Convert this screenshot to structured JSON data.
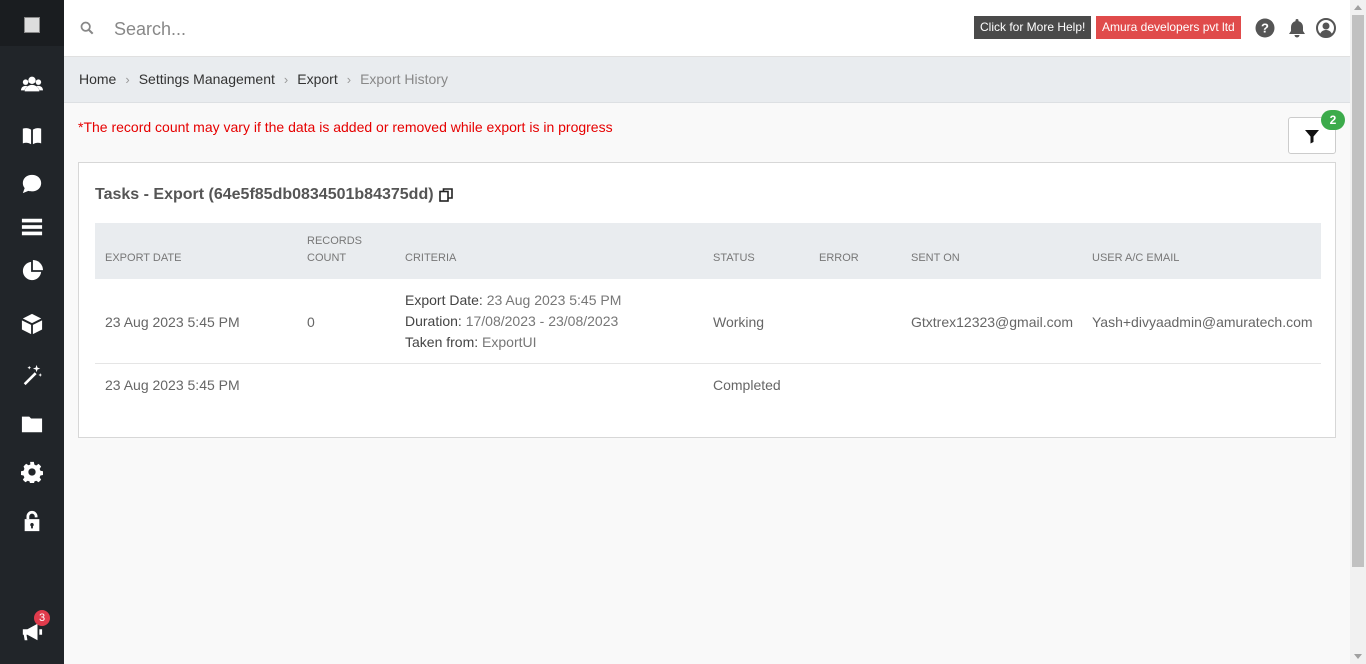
{
  "search": {
    "placeholder": "Search..."
  },
  "topbar": {
    "help_label": "Click for More Help!",
    "org_label": "Amura developers pvt ltd"
  },
  "sidebar": {
    "items": [
      {
        "name": "users",
        "icon": "users-icon"
      },
      {
        "name": "library",
        "icon": "book-icon"
      },
      {
        "name": "chat",
        "icon": "chat-icon"
      },
      {
        "name": "list",
        "icon": "list-icon"
      },
      {
        "name": "reports",
        "icon": "pie-chart-icon"
      },
      {
        "name": "products",
        "icon": "cube-icon"
      },
      {
        "name": "automation",
        "icon": "magic-wand-icon"
      },
      {
        "name": "files",
        "icon": "folder-icon"
      },
      {
        "name": "settings",
        "icon": "gear-icon"
      },
      {
        "name": "security",
        "icon": "lock-icon"
      }
    ],
    "announcements_badge": "3"
  },
  "breadcrumb": {
    "items": [
      "Home",
      "Settings Management",
      "Export"
    ],
    "current": "Export History"
  },
  "notice": "*The record count may vary if the data is added or removed while export is in progress",
  "filter": {
    "badge": "2"
  },
  "card": {
    "title": "Tasks - Export (64e5f85db0834501b84375dd)",
    "columns": [
      "Export Date",
      "Records Count",
      "Criteria",
      "Status",
      "Error",
      "Sent On",
      "User A/C Email"
    ],
    "rows": [
      {
        "export_date": "23 Aug 2023 5:45 PM",
        "records_count": "0",
        "criteria": {
          "export_date_label": "Export Date:",
          "export_date_value": "23 Aug 2023 5:45 PM",
          "duration_label": "Duration:",
          "duration_value": "17/08/2023 - 23/08/2023",
          "taken_from_label": "Taken from:",
          "taken_from_value": "ExportUI"
        },
        "status": "Working",
        "error": "",
        "sent_on": "Gtxtrex12323@gmail.com",
        "user_email": "Yash+divyaadmin@amuratech.com"
      },
      {
        "export_date": "23 Aug 2023 5:45 PM",
        "status": "Completed"
      }
    ]
  },
  "colors": {
    "sidebar_bg": "#212529",
    "notice": "#e60000",
    "org_button": "#e04b4b",
    "help_button": "#4a4a4a",
    "filter_badge": "#3cab4b",
    "announce_badge": "#e03b4c"
  }
}
